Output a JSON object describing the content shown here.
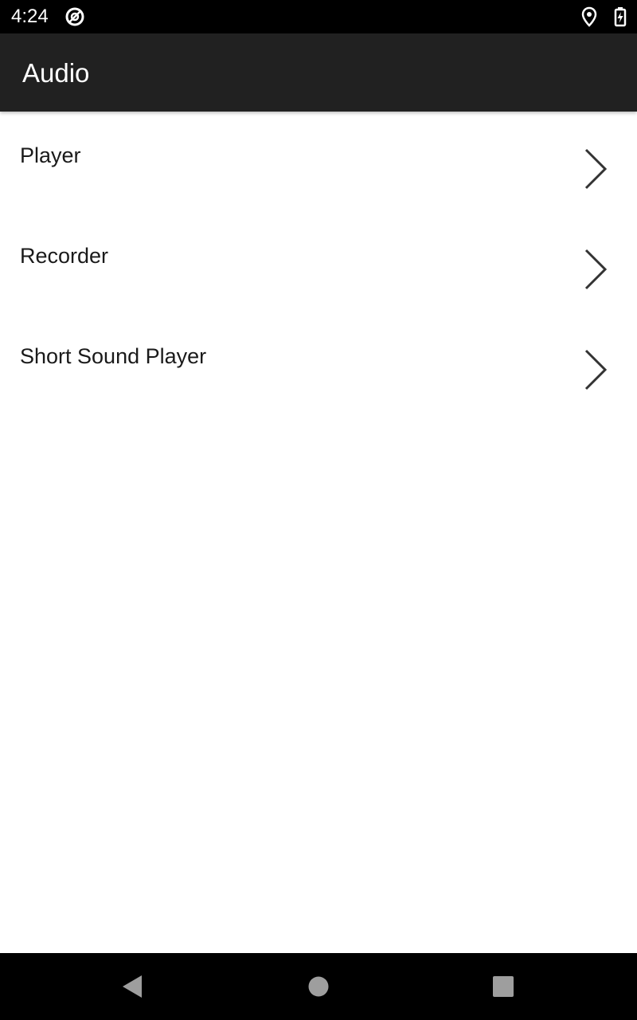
{
  "status_bar": {
    "time": "4:24",
    "left_icons": [
      "data-saver-icon"
    ],
    "right_icons": [
      "location-icon",
      "battery-charging-icon"
    ]
  },
  "app_bar": {
    "title": "Audio",
    "background": "#212121"
  },
  "list": {
    "items": [
      {
        "label": "Player",
        "icon": "chevron-right-icon"
      },
      {
        "label": "Recorder",
        "icon": "chevron-right-icon"
      },
      {
        "label": "Short Sound Player",
        "icon": "chevron-right-icon"
      }
    ]
  },
  "nav_bar": {
    "buttons": [
      "back-icon",
      "home-icon",
      "recents-icon"
    ],
    "icon_color": "#9e9e9e"
  }
}
